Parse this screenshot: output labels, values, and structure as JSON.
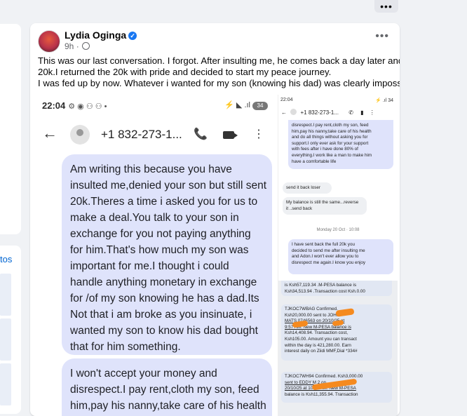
{
  "top_menu_label": "•••",
  "sidebar_link": "tos",
  "post": {
    "author": "Lydia Oginga",
    "verified_icon": "verified-badge-icon",
    "time": "9h",
    "separator": "·",
    "menu": "•••",
    "text_lines": [
      "This was our last conversation. I forgot. After insulting me, he comes back a day later and sends",
      "20k.I returned the 20k with pride and decided to start my peace journey.",
      "I was fed up by now. Whatever i wanted for my son (knowing his dad) was clearly impossible."
    ]
  },
  "screenshot1": {
    "time": "22:04",
    "status_icons": "⚙ ◉ ⚇ ⚇ •",
    "right_icons": "⚡ ◣ .ıl",
    "battery": "34",
    "contact": "+1 832-273-1...",
    "bubble1_lines": [
      "Am writing this because you have",
      "insulted me,denied your son but still sent",
      "20k.Theres a time i asked you for us to",
      "make a deal.You talk to your son in",
      "exchange for you not paying anything",
      "for him.That's how much my son was",
      "important for me.I thought i could",
      "handle anything monetary in exchange",
      "for /of my son knowing he has a dad.Its",
      "Not that i am broke as you insinuate, i",
      "wanted my son to know his dad bought",
      "that for him  something."
    ],
    "bubble2_lines": [
      "I won't accept your money and",
      "disrespect.I pay rent,cloth my son, feed",
      "him,pay his nanny,take care of his health"
    ]
  },
  "screenshot2": {
    "time": "22:04",
    "status_right": "⚡ .ıl 34",
    "contact": "+1 832-273-1...",
    "bubble_top_lines": [
      "disrespect.I pay rent,cloth my son, feed",
      "him,pay his nanny,take care of his health",
      "and do all things without asking you for",
      "support.I only ever ask for your support",
      "with fees after i have done 80% of",
      "everything.I work like a man to make him",
      "have a comfortable life"
    ],
    "reply1": "send it back loser",
    "reply2_lines": [
      "My balance is still the same...reverse",
      "it ..send back"
    ],
    "date": "Monday 20 Oct · 10:08",
    "bubble_mid_lines": [
      "I have sent back the full 20k you",
      "decided to send me after insulting me",
      "and Adon.I won't ever allow you to",
      "disrespect me again.I know you enjoy"
    ],
    "mpesa_top_lines": [
      "is Ksh57,119.34 .M-PESA balance is",
      "Ksh34,513.94 .Transaction cost Ksh.0.00"
    ],
    "mpesa1_lines": [
      "TJKOC7WBAG Confirmed.",
      "Ksh20,000.00 sent to JOHN",
      "MATS      0746563      on 20/10/25 at",
      "9:57 AM. New M-PESA balance is",
      "Ksh14,408.94. Transaction cost,",
      "Ksh105.00.  Amount you can transact",
      "within the day is 421,280.00. Earn",
      "interest daily on Ziidi MMF,Dial *334#"
    ],
    "mpesa2_lines": [
      "TJKOC7WH94 Confirmed. Ksh3,000.00",
      "sent to EDDY  M                2 on",
      "20/10/25 at 10:07 AM. New M-PESA",
      "balance is Ksh11,355.94. Transaction"
    ]
  },
  "colors": {
    "bubble_blue": "#dfe3fb",
    "verified": "#1877f2",
    "redaction": "#f58a1f"
  }
}
